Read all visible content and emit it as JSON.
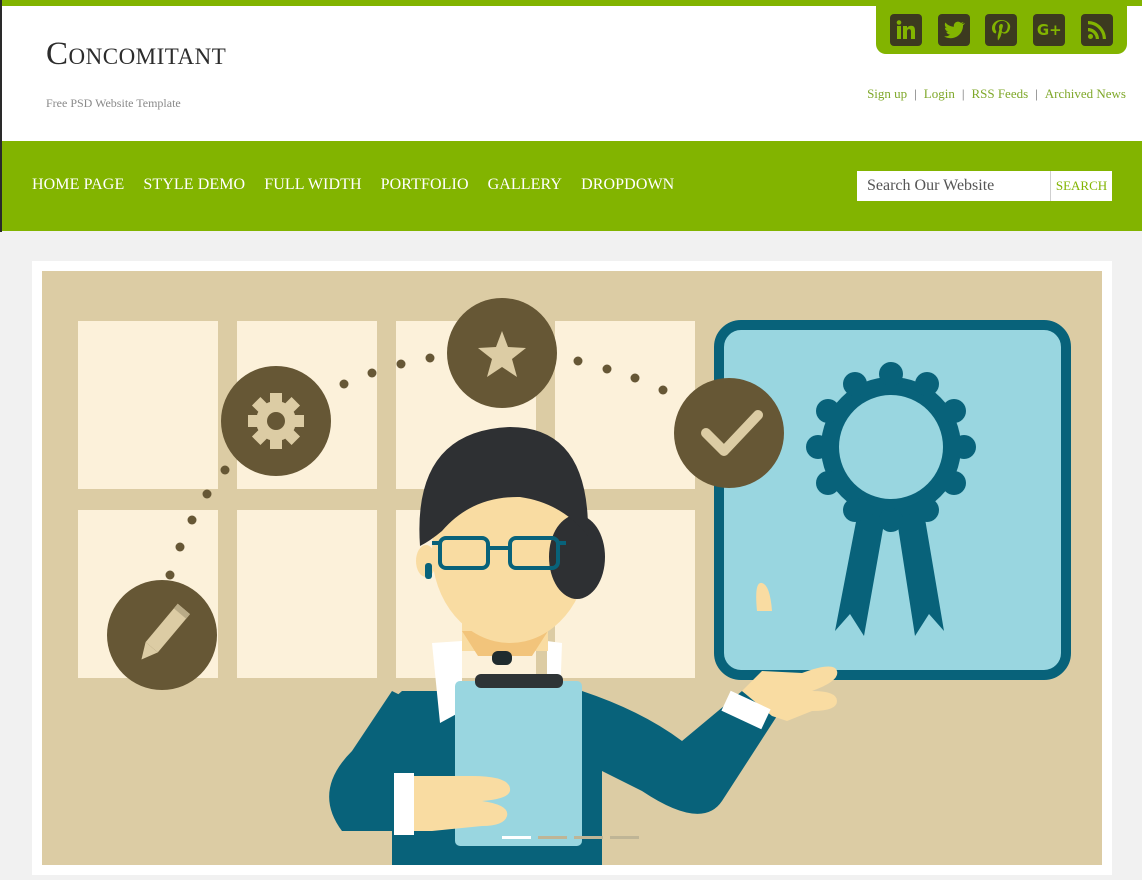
{
  "site": {
    "title": "Concomitant",
    "tagline": "Free PSD Website Template"
  },
  "social": [
    {
      "name": "linkedin-icon",
      "glyph": "in"
    },
    {
      "name": "twitter-icon",
      "glyph": ""
    },
    {
      "name": "pinterest-icon",
      "glyph": ""
    },
    {
      "name": "google-plus-icon",
      "glyph": "G+"
    },
    {
      "name": "rss-icon",
      "glyph": ""
    }
  ],
  "toplinks": {
    "signup": "Sign up",
    "login": "Login",
    "rss": "RSS Feeds",
    "archived": "Archived News"
  },
  "nav": {
    "items": [
      "Home Page",
      "Style Demo",
      "Full Width",
      "Portfolio",
      "Gallery",
      "Dropdown"
    ]
  },
  "search": {
    "placeholder": "Search Our Website",
    "button_label": "SEARCH"
  },
  "slider": {
    "slide_count": 4,
    "active_index": 0
  },
  "colors": {
    "accent": "#82b400",
    "link": "#7fa82a",
    "illustration_bg": "#dccca4",
    "circle": "#665735",
    "teal": "#08627a",
    "light_blue": "#99d6e0"
  }
}
